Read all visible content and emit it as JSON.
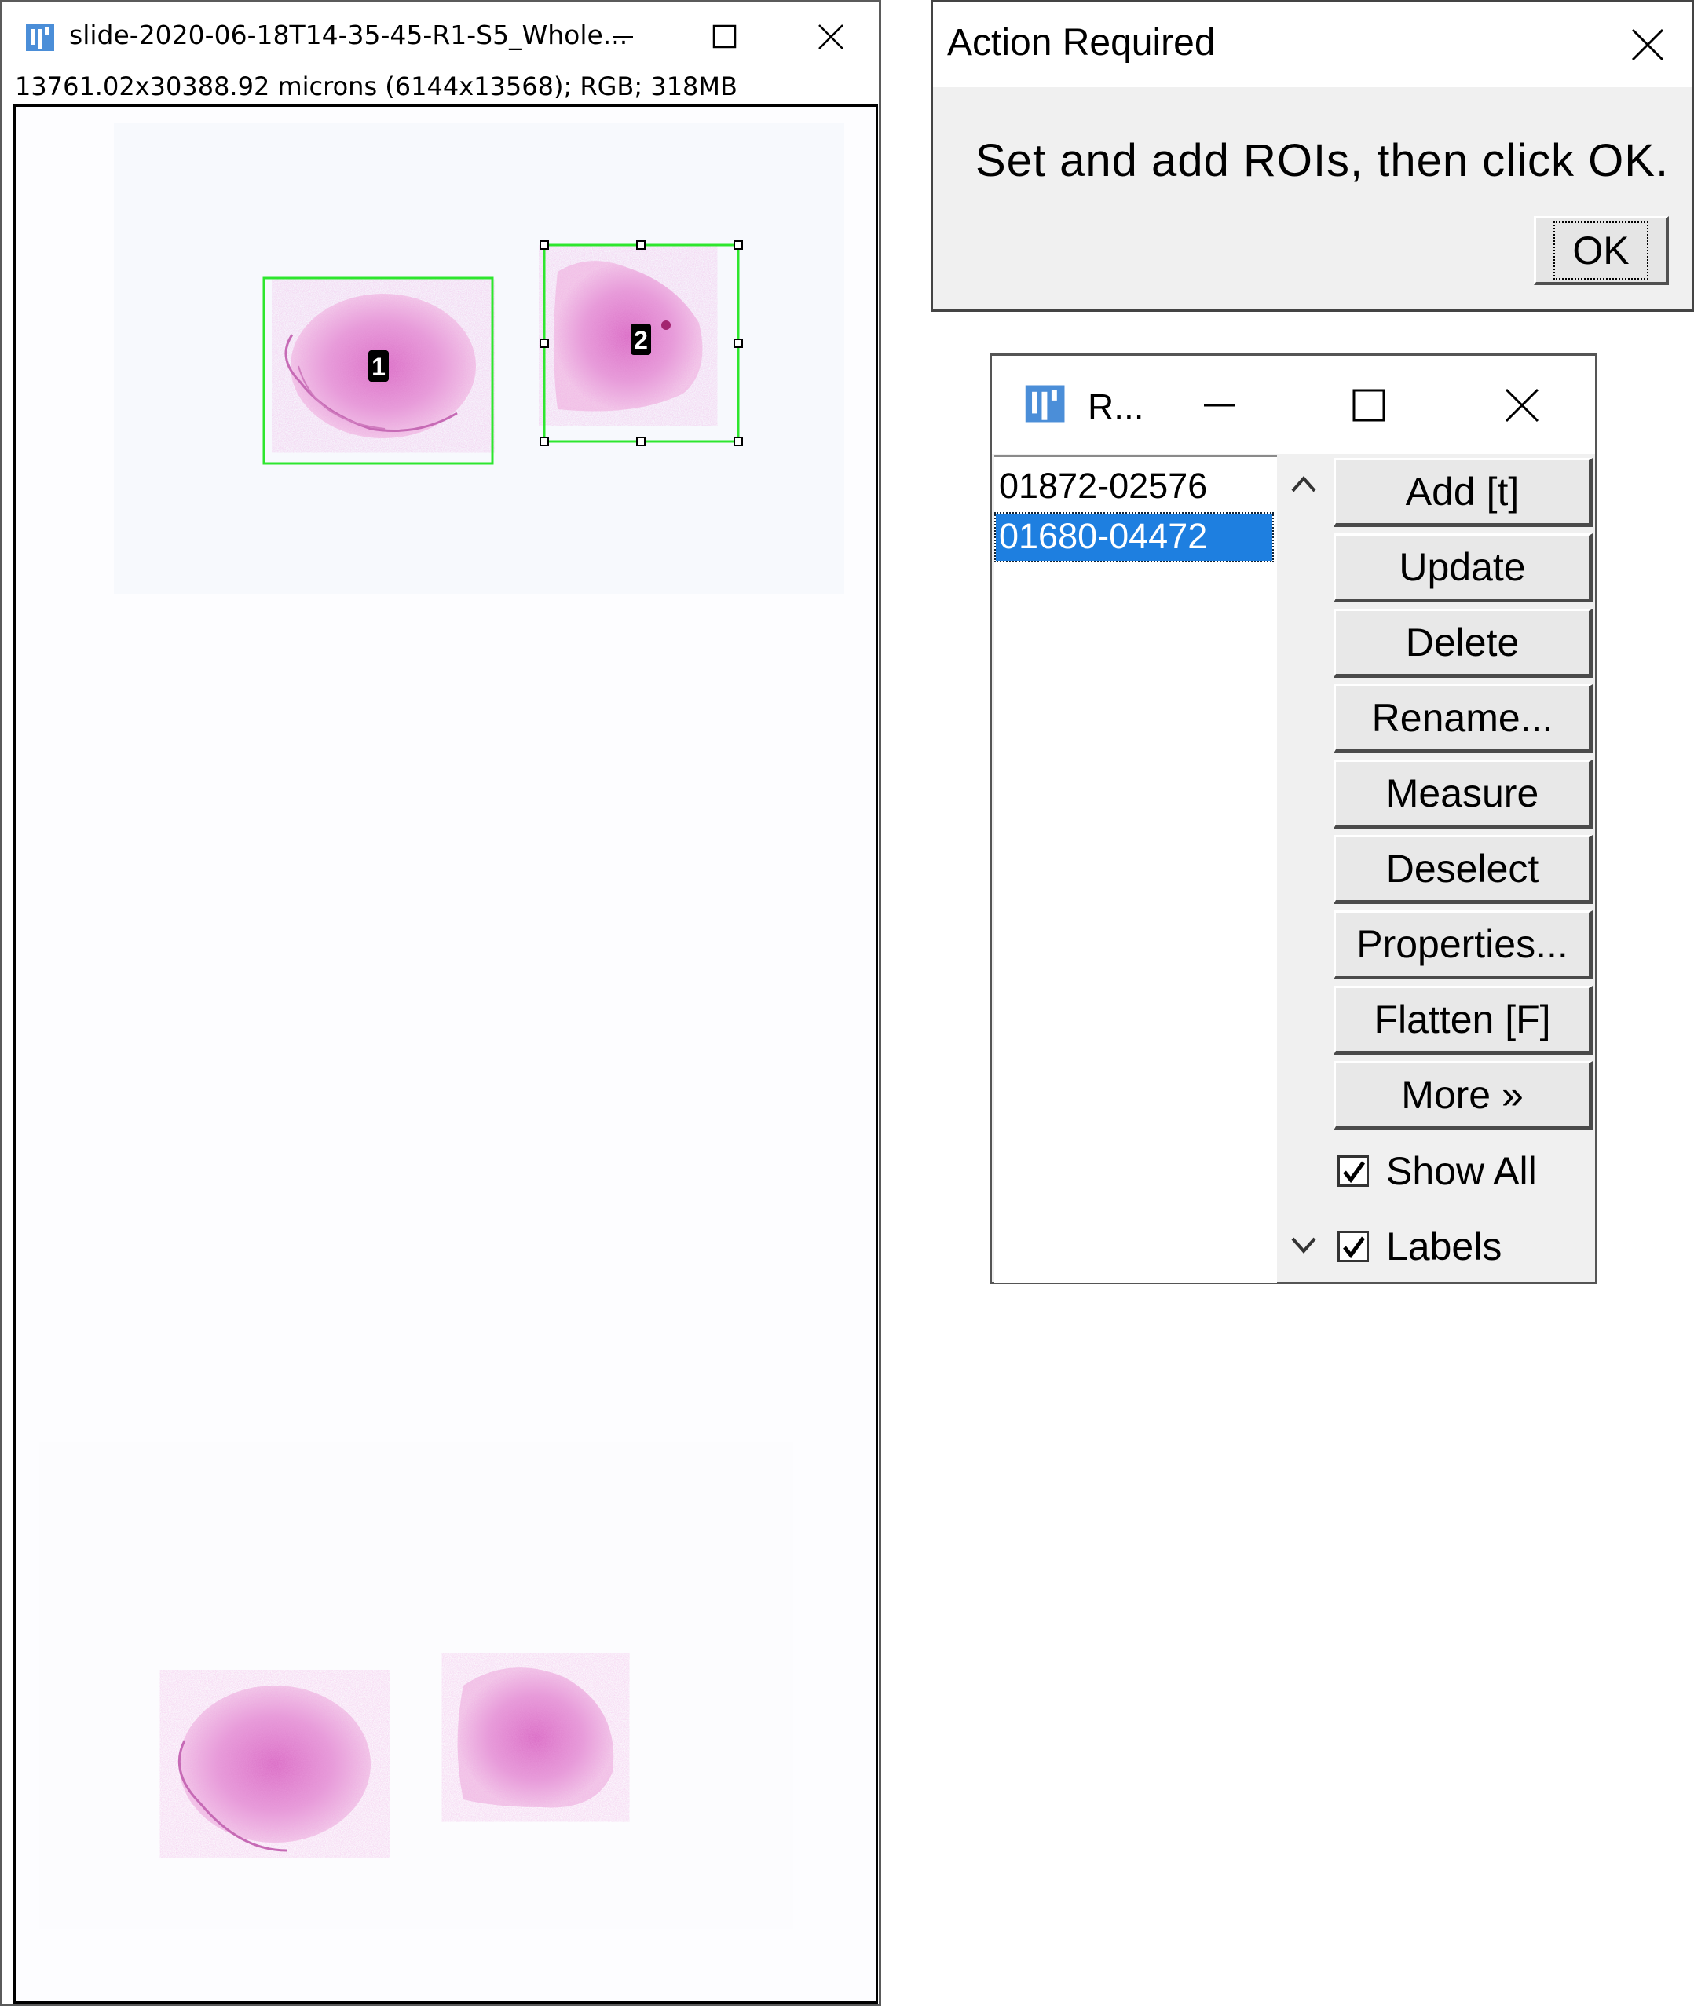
{
  "image_window": {
    "title": "slide-2020-06-18T14-35-45-R1-S5_Whole...",
    "info": "13761.02x30388.92 microns (6144x13568); RGB; 318MB",
    "roi_labels": [
      "1",
      "2"
    ]
  },
  "action_dialog": {
    "title": "Action Required",
    "message": "Set and add ROIs, then click OK.",
    "ok_label": "OK"
  },
  "roi_manager": {
    "title": "R...",
    "items": [
      "01872-02576",
      "01680-04472"
    ],
    "selected_index": 1,
    "buttons": [
      "Add [t]",
      "Update",
      "Delete",
      "Rename...",
      "Measure",
      "Deselect",
      "Properties...",
      "Flatten [F]",
      "More »"
    ],
    "checkboxes": [
      {
        "label": "Show All",
        "checked": true
      },
      {
        "label": "Labels",
        "checked": true
      }
    ]
  },
  "colors": {
    "roi_stroke": "#2ee62e",
    "selection_blue": "#1e7fe0",
    "tissue_pink": "#e58ad2"
  }
}
